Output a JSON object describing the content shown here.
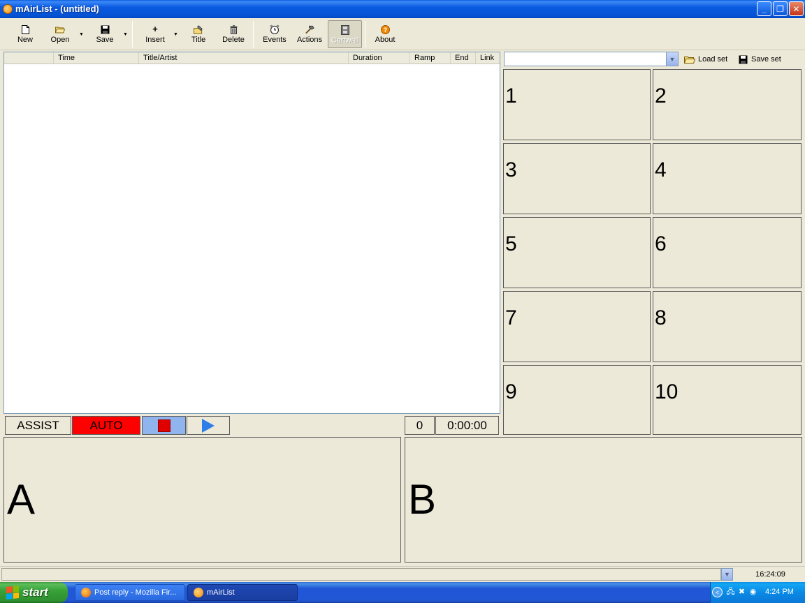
{
  "window": {
    "title": "mAirList - (untitled)",
    "controls": {
      "minimize": "_",
      "maximize": "❐",
      "close": "✕"
    }
  },
  "toolbar": {
    "new": "New",
    "open": "Open",
    "save": "Save",
    "insert": "Insert",
    "title": "Title",
    "delete": "Delete",
    "events": "Events",
    "actions": "Actions",
    "cartwall": "Cartwall",
    "about": "About"
  },
  "playlist": {
    "columns": [
      "Time",
      "Title/Artist",
      "Duration",
      "Ramp",
      "End",
      "Link"
    ]
  },
  "transport": {
    "assist": "ASSIST",
    "auto": "AUTO",
    "counter": "0",
    "timer": "0:00:00"
  },
  "players": {
    "a": "A",
    "b": "B"
  },
  "cartwall": {
    "load_set": "Load set",
    "save_set": "Save set",
    "carts": [
      "1",
      "2",
      "3",
      "4",
      "5",
      "6",
      "7",
      "8",
      "9",
      "10"
    ]
  },
  "statusbar": {
    "clock": "16:24:09"
  },
  "taskbar": {
    "start": "start",
    "items": [
      "Post reply - Mozilla Fir...",
      "mAirList"
    ],
    "clock": "4:24 PM"
  },
  "colors": {
    "auto_bg": "#ff0000",
    "stop_bg": "#90b4ee",
    "stop_square": "#e00000",
    "play_triangle": "#2e7ee8"
  }
}
